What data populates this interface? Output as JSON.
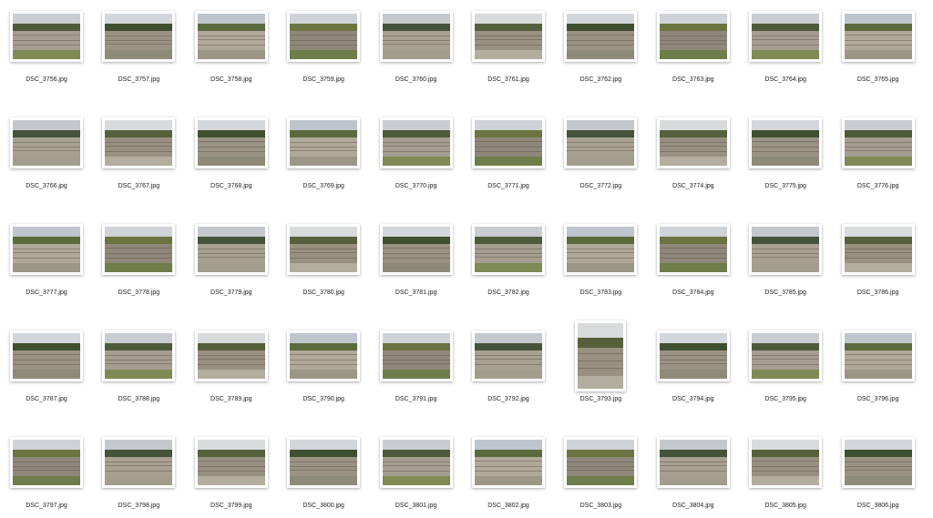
{
  "files": [
    {
      "name": "DSC_3756.jpg",
      "o": "L",
      "v": 0
    },
    {
      "name": "DSC_3757.jpg",
      "o": "L",
      "v": 1
    },
    {
      "name": "DSC_3758.jpg",
      "o": "L",
      "v": 2
    },
    {
      "name": "DSC_3759.jpg",
      "o": "L",
      "v": 3
    },
    {
      "name": "DSC_3760.jpg",
      "o": "L",
      "v": 4
    },
    {
      "name": "DSC_3761.jpg",
      "o": "L",
      "v": 5
    },
    {
      "name": "DSC_3762.jpg",
      "o": "L",
      "v": 1
    },
    {
      "name": "DSC_3763.jpg",
      "o": "L",
      "v": 3
    },
    {
      "name": "DSC_3764.jpg",
      "o": "L",
      "v": 0
    },
    {
      "name": "DSC_3765.jpg",
      "o": "L",
      "v": 2
    },
    {
      "name": "DSC_3766.jpg",
      "o": "L",
      "v": 4
    },
    {
      "name": "DSC_3767.jpg",
      "o": "L",
      "v": 5
    },
    {
      "name": "DSC_3768.jpg",
      "o": "L",
      "v": 1
    },
    {
      "name": "DSC_3769.jpg",
      "o": "L",
      "v": 2
    },
    {
      "name": "DSC_3770.jpg",
      "o": "L",
      "v": 0
    },
    {
      "name": "DSC_3771.jpg",
      "o": "L",
      "v": 3
    },
    {
      "name": "DSC_3772.jpg",
      "o": "L",
      "v": 4
    },
    {
      "name": "DSC_3774.jpg",
      "o": "L",
      "v": 5
    },
    {
      "name": "DSC_3775.jpg",
      "o": "L",
      "v": 1
    },
    {
      "name": "DSC_3776.jpg",
      "o": "L",
      "v": 0
    },
    {
      "name": "DSC_3777.jpg",
      "o": "L",
      "v": 2
    },
    {
      "name": "DSC_3778.jpg",
      "o": "L",
      "v": 3
    },
    {
      "name": "DSC_3779.jpg",
      "o": "L",
      "v": 4
    },
    {
      "name": "DSC_3780.jpg",
      "o": "L",
      "v": 5
    },
    {
      "name": "DSC_3781.jpg",
      "o": "L",
      "v": 1
    },
    {
      "name": "DSC_3782.jpg",
      "o": "L",
      "v": 0
    },
    {
      "name": "DSC_3783.jpg",
      "o": "L",
      "v": 2
    },
    {
      "name": "DSC_3784.jpg",
      "o": "L",
      "v": 3
    },
    {
      "name": "DSC_3785.jpg",
      "o": "L",
      "v": 4
    },
    {
      "name": "DSC_3786.jpg",
      "o": "L",
      "v": 5
    },
    {
      "name": "DSC_3787.jpg",
      "o": "L",
      "v": 1
    },
    {
      "name": "DSC_3788.jpg",
      "o": "L",
      "v": 0
    },
    {
      "name": "DSC_3789.jpg",
      "o": "L",
      "v": 5
    },
    {
      "name": "DSC_3790.jpg",
      "o": "L",
      "v": 2
    },
    {
      "name": "DSC_3791.jpg",
      "o": "L",
      "v": 3
    },
    {
      "name": "DSC_3792.jpg",
      "o": "L",
      "v": 4
    },
    {
      "name": "DSC_3793.jpg",
      "o": "P",
      "v": 5
    },
    {
      "name": "DSC_3794.jpg",
      "o": "L",
      "v": 1
    },
    {
      "name": "DSC_3795.jpg",
      "o": "L",
      "v": 0
    },
    {
      "name": "DSC_3796.jpg",
      "o": "L",
      "v": 2
    },
    {
      "name": "DSC_3797.jpg",
      "o": "L",
      "v": 3
    },
    {
      "name": "DSC_3798.jpg",
      "o": "L",
      "v": 4
    },
    {
      "name": "DSC_3799.jpg",
      "o": "L",
      "v": 5
    },
    {
      "name": "DSC_3800.jpg",
      "o": "L",
      "v": 1
    },
    {
      "name": "DSC_3801.jpg",
      "o": "L",
      "v": 0
    },
    {
      "name": "DSC_3802.jpg",
      "o": "L",
      "v": 2
    },
    {
      "name": "DSC_3803.jpg",
      "o": "L",
      "v": 3
    },
    {
      "name": "DSC_3804.jpg",
      "o": "L",
      "v": 4
    },
    {
      "name": "DSC_3805.jpg",
      "o": "L",
      "v": 5
    },
    {
      "name": "DSC_3806.jpg",
      "o": "L",
      "v": 1
    }
  ],
  "palettes": [
    {
      "sky": "#c9ccd0",
      "trees": "#4d5b3a",
      "stone": "#a59e90",
      "ground": "#7f8a55"
    },
    {
      "sky": "#d3d6da",
      "trees": "#3f4f30",
      "stone": "#9a9384",
      "ground": "#8e8a78"
    },
    {
      "sky": "#bfc5cc",
      "trees": "#5a6a3d",
      "stone": "#b0a898",
      "ground": "#9c9687"
    },
    {
      "sky": "#cfd2d6",
      "trees": "#6b7440",
      "stone": "#8f887a",
      "ground": "#6f7d4a"
    },
    {
      "sky": "#c4c8cc",
      "trees": "#44533a",
      "stone": "#a8a192",
      "ground": "#a39d8d"
    },
    {
      "sky": "#d8dadc",
      "trees": "#56603c",
      "stone": "#989080",
      "ground": "#b3ad9f"
    }
  ]
}
